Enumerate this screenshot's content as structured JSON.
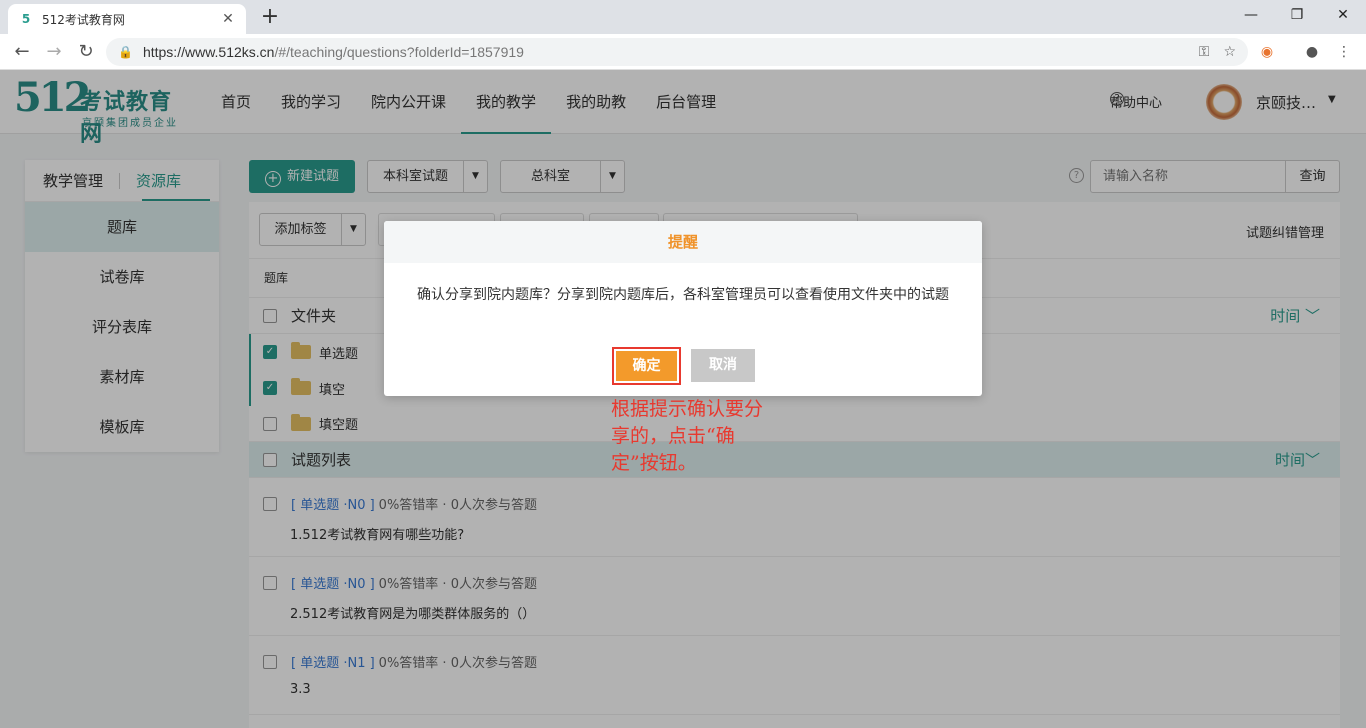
{
  "browser": {
    "tab_title": "512考试教育网",
    "url_host": "https://www.512ks.cn",
    "url_path": "/#/teaching/questions?folderId=1857919"
  },
  "header": {
    "logo_num": "512",
    "logo_text": "考试教育网",
    "logo_sub": "京颐集团成员企业",
    "nav": [
      {
        "label": "首页"
      },
      {
        "label": "我的学习"
      },
      {
        "label": "院内公开课"
      },
      {
        "label": "我的教学"
      },
      {
        "label": "我的助教"
      },
      {
        "label": "后台管理"
      }
    ],
    "help": "帮助中心",
    "user": "京颐技…"
  },
  "sidebar": {
    "tabs": [
      "教学管理",
      "资源库"
    ],
    "items": [
      {
        "label": "题库"
      },
      {
        "label": "试卷库"
      },
      {
        "label": "评分表库"
      },
      {
        "label": "素材库"
      },
      {
        "label": "模板库"
      }
    ]
  },
  "toolbar": {
    "new_question": "新建试题",
    "dept_questions": "本科室试题",
    "dept_all": "总科室",
    "search_placeholder": "请输入名称",
    "search_btn": "查询",
    "add_tag": "添加标签",
    "error_mgr": "试题纠错管理"
  },
  "list": {
    "crumb": "题库",
    "folder_head": "文件夹",
    "sort_label": "时间",
    "folders": [
      {
        "name": "单选题",
        "checked": true
      },
      {
        "name": "填空",
        "checked": true
      },
      {
        "name": "填空题",
        "checked": false
      }
    ],
    "question_head": "试题列表",
    "questions": [
      {
        "tag": "[ 单选题 ·N0 ]",
        "meta": "0%答错率 · 0人次参与答题",
        "text": "1.512考试教育网有哪些功能?"
      },
      {
        "tag": "[ 单选题 ·N0 ]",
        "meta": "0%答错率 · 0人次参与答题",
        "text": "2.512考试教育网是为哪类群体服务的（）"
      },
      {
        "tag": "[ 单选题 ·N1 ]",
        "meta": "0%答错率 · 0人次参与答题",
        "text": "3.3"
      }
    ]
  },
  "dialog": {
    "title": "提醒",
    "message": "确认分享到院内题库？分享到院内题库后，各科室管理员可以查看使用文件夹中的试题",
    "ok": "确定",
    "cancel": "取消"
  },
  "annotation": "根据提示确认要分享的，点击“确定”按钮。",
  "colors": {
    "accent": "#2a9d8f",
    "warning": "#f39a2b",
    "highlight": "#e8392f"
  }
}
